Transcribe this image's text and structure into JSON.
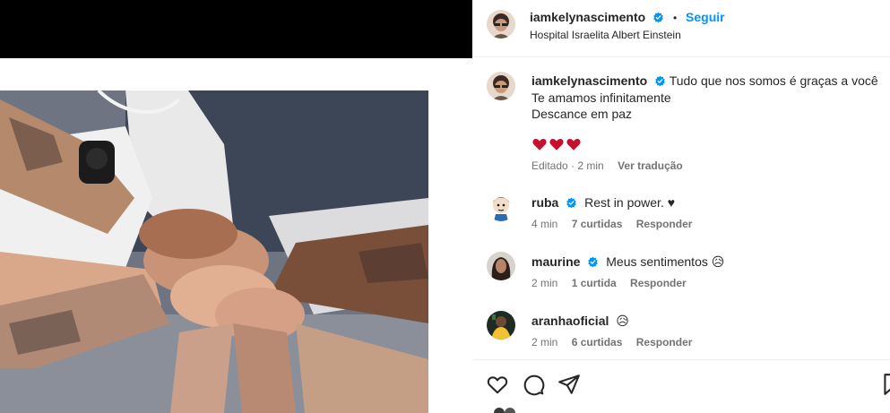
{
  "post": {
    "author": "iamkelynascimento",
    "location": "Hospital Israelita Albert Einstein",
    "follow_label": "Seguir",
    "dot": "•"
  },
  "caption": {
    "username": "iamkelynascimento",
    "line1": "Tudo que nos somos é graças a você",
    "line2": "Te amamos infinitamente",
    "line3": "Descance em paz",
    "edited": "Editado · 2 min",
    "translate": "Ver tradução"
  },
  "comments": [
    {
      "username": "ruba",
      "text": "Rest in power. ♥",
      "time": "4 min",
      "likes": "7 curtidas",
      "reply": "Responder",
      "verified": true
    },
    {
      "username": "maurine",
      "text": "Meus sentimentos 😥",
      "time": "2 min",
      "likes": "1 curtida",
      "reply": "Responder",
      "verified": true
    },
    {
      "username": "aranhaoficial",
      "text": "😥",
      "time": "2 min",
      "likes": "6 curtidas",
      "reply": "Responder",
      "verified": false
    }
  ],
  "colors": {
    "accent": "#0095f6",
    "verified": "#0095f6",
    "heart": "#c8102e",
    "muted": "#737373"
  },
  "icons": [
    "verified-badge-icon",
    "heart-icon",
    "comment-icon",
    "share-icon",
    "bookmark-icon"
  ]
}
